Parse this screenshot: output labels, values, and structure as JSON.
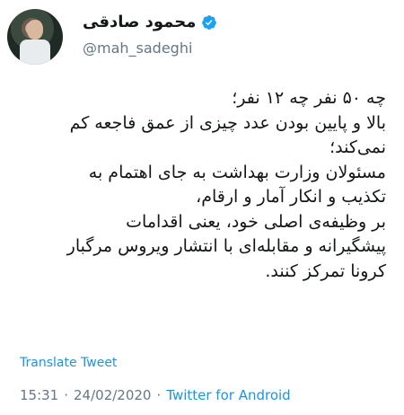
{
  "author": {
    "name": "محمود صادقی",
    "handle": "@mah_sadeghi",
    "verified": true,
    "avatar_icon": "profile-photo"
  },
  "tweet": {
    "lines": [
      "چه ۵۰ نفر چه ۱۲ نفر؛",
      "بالا و پایین بودن عدد چیزی از عمق فاجعه کم",
      "نمی‌کند؛",
      "مسئولان وزارت بهداشت به جای اهتمام به",
      "تکذیب و انکار آمار و ارقام،",
      "بر وظیفه‌ی اصلی خود، یعنی اقدامات",
      "پیشگیرانه و مقابله‌ای با انتشار ویروس مرگبار",
      "کرونا تمرکز کنند."
    ]
  },
  "translate_label": "Translate Tweet",
  "meta": {
    "time": "15:31",
    "separator": "·",
    "date": "24/02/2020",
    "source": "Twitter for Android"
  },
  "colors": {
    "link": "#1b95e0",
    "muted": "#657786",
    "verified": "#1da1f2"
  }
}
